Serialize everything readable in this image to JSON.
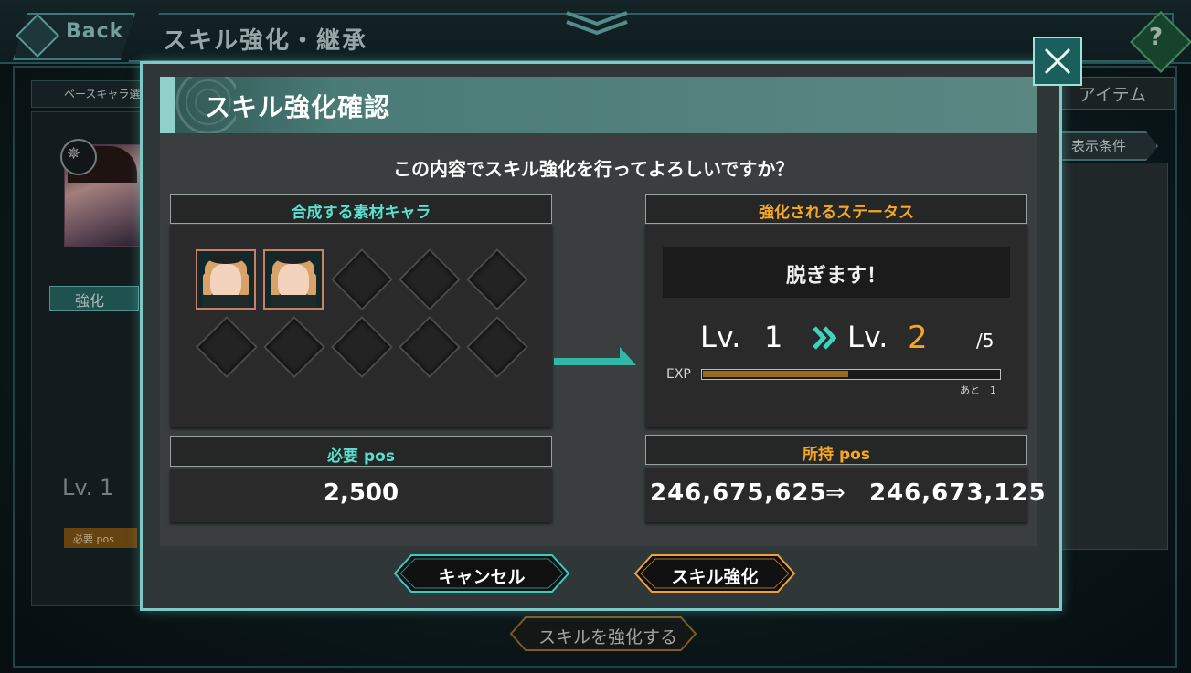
{
  "background": {
    "back_label": "Back",
    "page_title": "スキル強化・継承",
    "base_tab": "ベースキャラ選",
    "item_tab": "アイテム",
    "filter_button": "表示条件",
    "enhance_tab": "強化",
    "level_text": "Lv.  1",
    "required_pos_badge": "必要 pos",
    "execute_button": "スキルを強化する",
    "help_icon": "?"
  },
  "modal": {
    "title": "スキル強化確認",
    "question": "この内容でスキル強化を行ってよろしいですか？",
    "materials": {
      "header": "合成する素材キャラ",
      "filled_slots": 2,
      "total_slots": 10
    },
    "status": {
      "header": "強化されるステータス",
      "skill_name": "脱ぎます！",
      "level_label": "Lv.",
      "current_level": "1",
      "new_level": "2",
      "max_level": "/5",
      "exp_label": "EXP",
      "exp_fill_fraction": 0.49,
      "exp_remaining": "あと　1"
    },
    "required_pos": {
      "header": "必要 pos",
      "value": "2,500"
    },
    "owned_pos": {
      "header": "所持 pos",
      "before": "246,675,625",
      "arrow": "⇒",
      "after": "246,673,125"
    },
    "buttons": {
      "cancel": "キャンセル",
      "confirm": "スキル強化"
    }
  },
  "colors": {
    "teal_accent": "#59e0cf",
    "orange_accent": "#f5a623",
    "frame_border": "#7ec9c5"
  }
}
